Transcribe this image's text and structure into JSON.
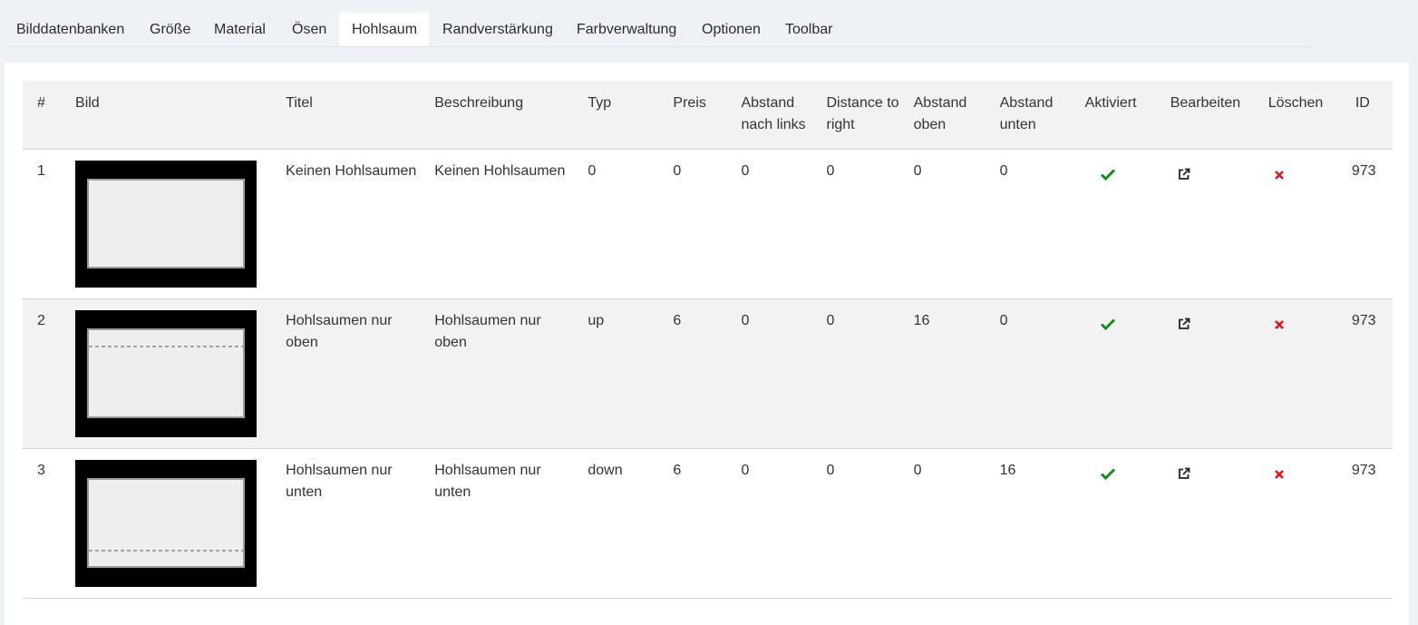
{
  "tabs": [
    {
      "label": "Bilddatenbanken",
      "active": false
    },
    {
      "label": "Größe",
      "active": false
    },
    {
      "label": "Material",
      "active": false
    },
    {
      "label": "Ösen",
      "active": false
    },
    {
      "label": "Hohlsaum",
      "active": true
    },
    {
      "label": "Randverstärkung",
      "active": false
    },
    {
      "label": "Farbverwaltung",
      "active": false
    },
    {
      "label": "Optionen",
      "active": false
    },
    {
      "label": "Toolbar",
      "active": false
    }
  ],
  "table": {
    "headers": {
      "num": "#",
      "image": "Bild",
      "title": "Titel",
      "description": "Beschreibung",
      "type": "Typ",
      "price": "Preis",
      "left": "Abstand nach links",
      "right": "Distance to right",
      "top": "Abstand oben",
      "bottom": "Abstand unten",
      "active": "Aktiviert",
      "edit": "Bearbeiten",
      "delete": "Löschen",
      "id": "ID"
    },
    "rows": [
      {
        "num": "1",
        "title": "Keinen Hohlsaumen",
        "description": "Keinen Hohlsaumen",
        "type": "0",
        "price": "0",
        "left": "0",
        "right": "0",
        "top": "0",
        "bottom": "0",
        "id": "973",
        "hem": "none",
        "active_icon": "check-icon",
        "edit_icon": "external-link-icon",
        "delete_icon": "close-icon"
      },
      {
        "num": "2",
        "title": "Hohlsaumen nur oben",
        "description": "Hohlsaumen nur oben",
        "type": "up",
        "price": "6",
        "left": "0",
        "right": "0",
        "top": "16",
        "bottom": "0",
        "id": "973",
        "hem": "top",
        "active_icon": "check-icon",
        "edit_icon": "external-link-icon",
        "delete_icon": "close-icon"
      },
      {
        "num": "3",
        "title": "Hohlsaumen nur unten",
        "description": "Hohlsaumen nur unten",
        "type": "down",
        "price": "6",
        "left": "0",
        "right": "0",
        "top": "0",
        "bottom": "16",
        "id": "973",
        "hem": "bottom",
        "active_icon": "check-icon",
        "edit_icon": "external-link-icon",
        "delete_icon": "close-icon"
      }
    ]
  },
  "colors": {
    "check": "#1a8a1a",
    "delete": "#e0141e",
    "row_alt": "#f2f2f2",
    "page_bg": "#eef2f6"
  }
}
